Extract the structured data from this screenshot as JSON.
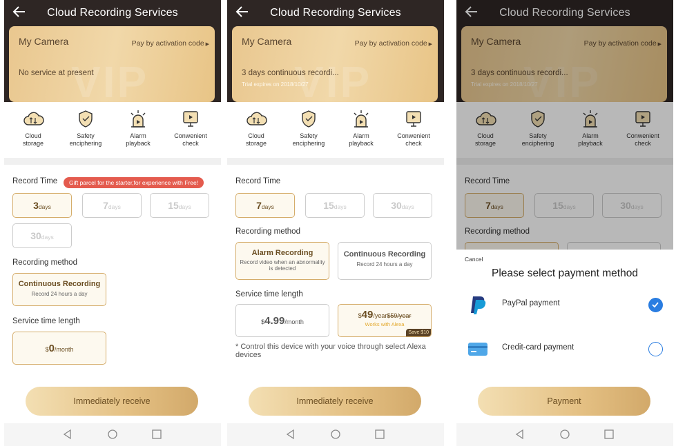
{
  "header": {
    "title": "Cloud Recording Services"
  },
  "card": {
    "camera": "My Camera",
    "pay_link": "Pay by activation code",
    "status_none": "No service at present",
    "status_active": "3 days continuous recordi...",
    "trial": "Trial expires on 2018/10/27",
    "watermark": "VIP"
  },
  "features": [
    {
      "line1": "Cloud",
      "line2": "storage",
      "icon": "cloud-icon"
    },
    {
      "line1": "Safety",
      "line2": "enciphering",
      "icon": "shield-icon"
    },
    {
      "line1": "Alarm",
      "line2": "playback",
      "icon": "alarm-icon"
    },
    {
      "line1": "Conwenient",
      "line2": "check",
      "icon": "monitor-icon"
    }
  ],
  "sections": {
    "record_time": "Record Time",
    "method": "Recording method",
    "length": "Service time length"
  },
  "gift": "Gift parcel for the starter,for experience with Free!",
  "days_unit": "days",
  "screen1": {
    "days": [
      "3",
      "7",
      "15",
      "30"
    ],
    "method": {
      "title": "Continuous Recording",
      "sub": "Record 24 hours a day"
    },
    "price": {
      "cur": "$",
      "amount": "0",
      "unit": "/month"
    }
  },
  "screen2": {
    "days": [
      "7",
      "15",
      "30"
    ],
    "methods": [
      {
        "title": "Alarm Recording",
        "sub": "Record video when an abnormality is detected"
      },
      {
        "title": "Continuous Recording",
        "sub": "Record 24 hours a day"
      }
    ],
    "price_monthly": {
      "cur": "$",
      "amount": "4.99",
      "unit": "/month"
    },
    "price_yearly": {
      "cur": "$",
      "amount": "49",
      "unit": "/year",
      "old": "$59/year",
      "alexa": "Works with Alexa",
      "save": "Save $10"
    },
    "note": "* Control this device with your voice through select Alexa devices"
  },
  "buttons": {
    "receive": "Immediately receive",
    "payment": "Payment"
  },
  "sheet": {
    "cancel": "Cancel",
    "title": "Please select payment method",
    "methods": [
      {
        "label": "PayPal payment",
        "selected": true
      },
      {
        "label": "Credit-card payment",
        "selected": false
      }
    ]
  },
  "colors": {
    "accent": "#d5ad6b",
    "gift": "#e45b4e",
    "radio": "#2a7de1",
    "header": "#2e2624"
  }
}
